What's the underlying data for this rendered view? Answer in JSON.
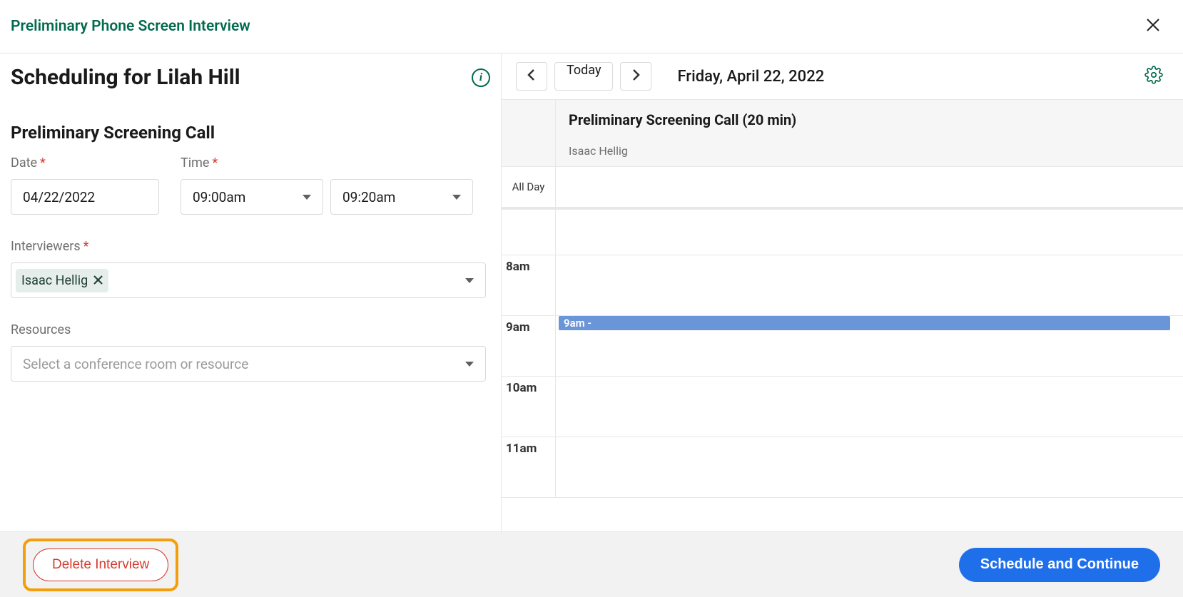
{
  "header": {
    "title": "Preliminary Phone Screen Interview"
  },
  "left": {
    "heading": "Scheduling for Lilah Hill",
    "section_title": "Preliminary Screening Call",
    "date_label": "Date",
    "time_label": "Time",
    "date_value": "04/22/2022",
    "time_start": "09:00am",
    "time_end": "09:20am",
    "interviewers_label": "Interviewers",
    "interviewers": [
      {
        "name": "Isaac Hellig"
      }
    ],
    "resources_label": "Resources",
    "resources_placeholder": "Select a conference room or resource"
  },
  "calendar": {
    "today_label": "Today",
    "display_date": "Friday, April 22, 2022",
    "resource_title": "Preliminary Screening Call (20 min)",
    "resource_subtitle": "Isaac Hellig",
    "all_day_label": "All Day",
    "hours": [
      "8am",
      "9am",
      "10am",
      "11am"
    ],
    "event_label": "9am -"
  },
  "footer": {
    "delete_label": "Delete Interview",
    "primary_label": "Schedule and Continue"
  }
}
